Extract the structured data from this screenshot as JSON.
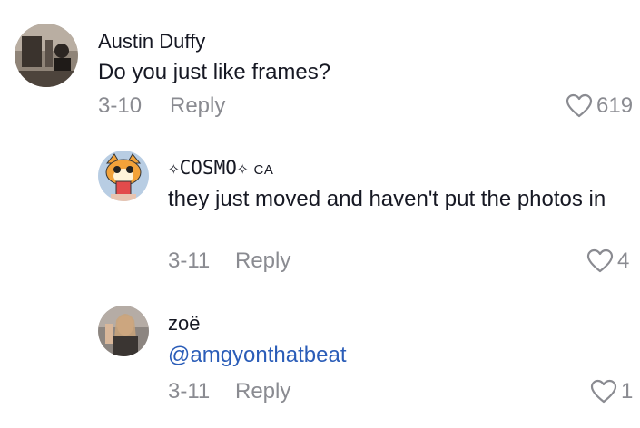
{
  "comments": [
    {
      "name": "Austin Duffy",
      "text": "Do you just like frames?",
      "date": "3-10",
      "reply_label": "Reply",
      "likes": "619"
    },
    {
      "name": "✧COSMO✧",
      "badge": "CA",
      "text": "they just moved and haven't put the photos in",
      "date": "3-11",
      "reply_label": "Reply",
      "likes": "4"
    },
    {
      "name": "zoë",
      "text": "@amgyonthatbeat",
      "date": "3-11",
      "reply_label": "Reply",
      "likes": "1"
    }
  ],
  "colors": {
    "text": "#161823",
    "muted": "#8a8b91",
    "mention": "#2b5db8"
  },
  "icons": [
    "avatar-photo",
    "heart-outline-icon"
  ]
}
